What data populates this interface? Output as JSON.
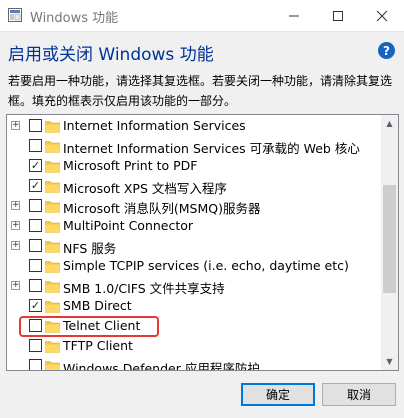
{
  "window": {
    "title": "Windows 功能",
    "controls": [
      "minimize",
      "maximize",
      "close"
    ]
  },
  "header": {
    "heading": "启用或关闭 Windows 功能",
    "help_glyph": "?",
    "description": "若要启用一种功能，请选择其复选框。若要关闭一种功能，请清除其复选框。填充的框表示仅启用该功能的一部分。"
  },
  "features": [
    {
      "label": "Internet Information Services",
      "expander": "+",
      "checked": false
    },
    {
      "label": "Internet Information Services 可承载的 Web 核心",
      "expander": "",
      "checked": false
    },
    {
      "label": "Microsoft Print to PDF",
      "expander": "",
      "checked": true
    },
    {
      "label": "Microsoft XPS 文档写入程序",
      "expander": "",
      "checked": true
    },
    {
      "label": "Microsoft 消息队列(MSMQ)服务器",
      "expander": "+",
      "checked": false
    },
    {
      "label": "MultiPoint Connector",
      "expander": "+",
      "checked": false
    },
    {
      "label": "NFS 服务",
      "expander": "+",
      "checked": false
    },
    {
      "label": "Simple TCPIP services (i.e. echo, daytime etc)",
      "expander": "",
      "checked": false
    },
    {
      "label": "SMB 1.0/CIFS 文件共享支持",
      "expander": "+",
      "checked": false
    },
    {
      "label": "SMB Direct",
      "expander": "",
      "checked": true
    },
    {
      "label": "Telnet Client",
      "expander": "",
      "checked": false
    },
    {
      "label": "TFTP Client",
      "expander": "",
      "checked": false
    },
    {
      "label": "Windows Defender 应用程序防护",
      "expander": "",
      "checked": false
    }
  ],
  "check_glyph": "✓",
  "colors": {
    "heading": "#003399",
    "highlight": "#e53935",
    "folder": "#f5c842",
    "primary_border": "#0078d7"
  },
  "buttons": {
    "ok": "确定",
    "cancel": "取消"
  }
}
